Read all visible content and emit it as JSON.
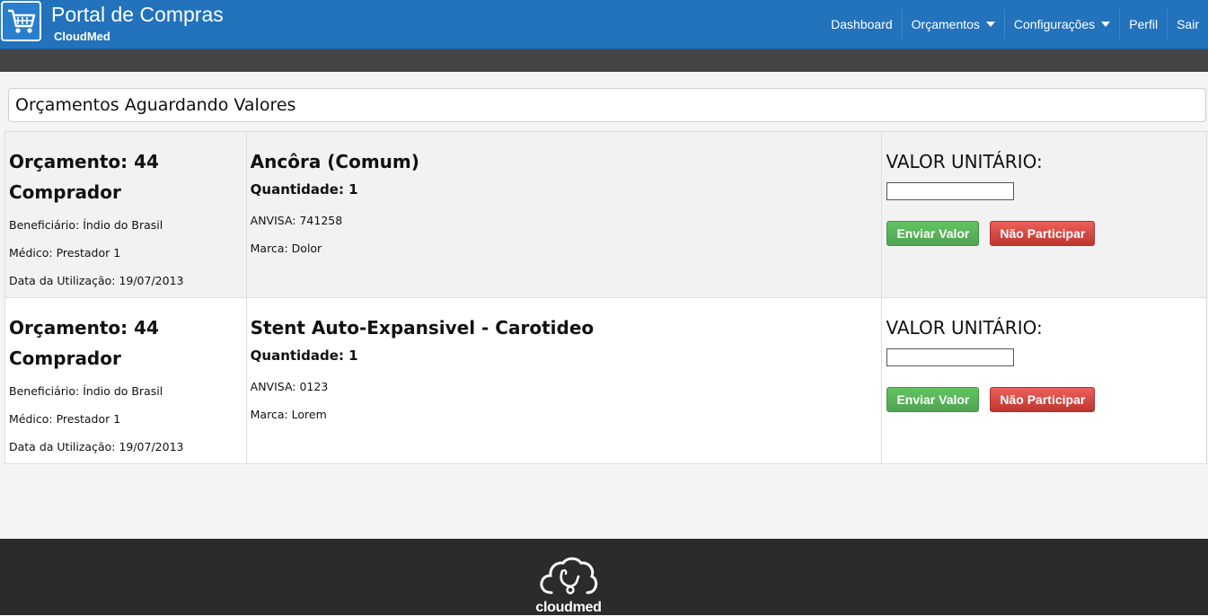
{
  "header": {
    "title": "Portal de Compras",
    "subtitle": "CloudMed",
    "nav": [
      {
        "label": "Dashboard",
        "dropdown": false
      },
      {
        "label": "Orçamentos",
        "dropdown": true
      },
      {
        "label": "Configurações",
        "dropdown": true
      },
      {
        "label": "Perfil",
        "dropdown": false
      },
      {
        "label": "Sair",
        "dropdown": false
      }
    ]
  },
  "main": {
    "heading": "Orçamentos Aguardando Valores",
    "quotes": [
      {
        "orcamento": "Orçamento: 44",
        "comprador": "Comprador",
        "beneficiario": "Beneficiário: Índio do Brasil",
        "medico": "Médico: Prestador 1",
        "data": "Data da Utilização: 19/07/2013",
        "produto": "Ancôra (Comum)",
        "quantidade": "Quantidade: 1",
        "anvisa": "ANVISA: 741258",
        "marca": "Marca: Dolor",
        "valor_label": "VALOR UNITÁRIO:",
        "valor_input": "",
        "send_label": "Enviar Valor",
        "decline_label": "Não Participar"
      },
      {
        "orcamento": "Orçamento: 44",
        "comprador": "Comprador",
        "beneficiario": "Beneficiário: Índio do Brasil",
        "medico": "Médico: Prestador 1",
        "data": "Data da Utilização: 19/07/2013",
        "produto": "Stent Auto-Expansivel - Carotideo",
        "quantidade": "Quantidade: 1",
        "anvisa": "ANVISA: 0123",
        "marca": "Marca: Lorem",
        "valor_label": "VALOR UNITÁRIO:",
        "valor_input": "",
        "send_label": "Enviar Valor",
        "decline_label": "Não Participar"
      }
    ]
  },
  "footer": {
    "logo_text": "cloudmed"
  },
  "icons": {
    "logo": "shopping-cart-icon",
    "footer_logo": "cloud-stethoscope-icon"
  },
  "colors": {
    "header_bg": "#2272bc",
    "subbar_bg": "#444444",
    "footer_bg": "#2b2b2b",
    "btn_send": "#5bb75b",
    "btn_decline": "#da4f49"
  }
}
